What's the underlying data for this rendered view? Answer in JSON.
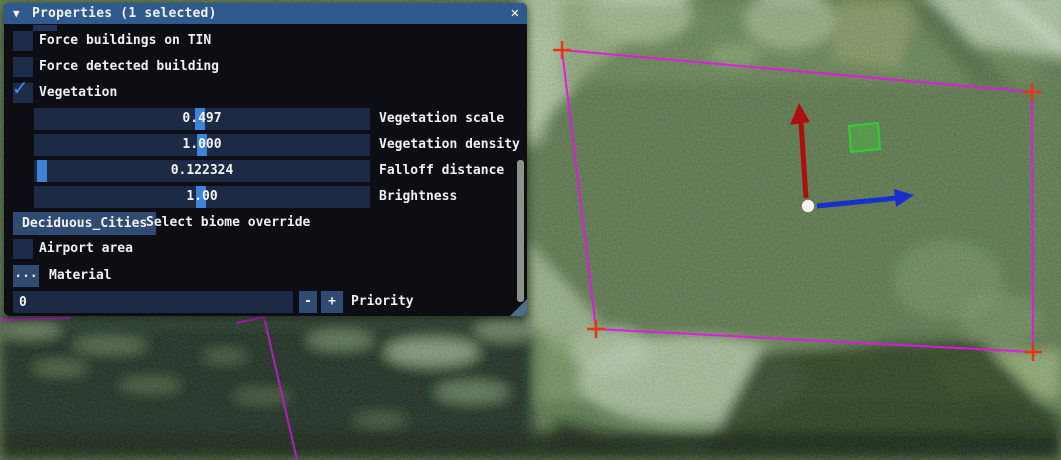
{
  "panel": {
    "header": {
      "collapse_icon": "▼",
      "title": "Properties (1 selected)",
      "close_icon": "✕"
    },
    "checkbox_rows": [
      {
        "label": "Force buildings on TIN",
        "check": ""
      },
      {
        "label": "Force detected building",
        "check": ""
      },
      {
        "label": "Vegetation",
        "check": "✓"
      }
    ],
    "sliders": [
      {
        "value": "0.497",
        "label": "Vegetation scale",
        "fraction": 0.494
      },
      {
        "value": "1.000",
        "label": "Vegetation density",
        "fraction": 0.4995
      },
      {
        "value": "0.122324",
        "label": "Falloff distance",
        "fraction": 0.024
      },
      {
        "value": "1.00",
        "label": "Brightness",
        "fraction": 0.496
      }
    ],
    "biome": {
      "button": "Deciduous_Cities",
      "label": "Select biome override"
    },
    "airport": {
      "label": "Airport area",
      "check": ""
    },
    "material": {
      "button": "...",
      "label": "Material"
    },
    "priority": {
      "value": "0",
      "minus": "-",
      "plus": "+",
      "label": "Priority"
    }
  },
  "colors": {
    "header_blue": "#2e5a8e",
    "accent_blue": "#3f82da",
    "button_blue": "#2f4b72",
    "field_navy": "#1c2a45",
    "selection_magenta": "#e615e6",
    "corner_marker_red": "#e63418",
    "axis_y_red": "#ad0f0f",
    "axis_x_blue": "#1530cf",
    "area_marker_green": "#31ce31"
  }
}
